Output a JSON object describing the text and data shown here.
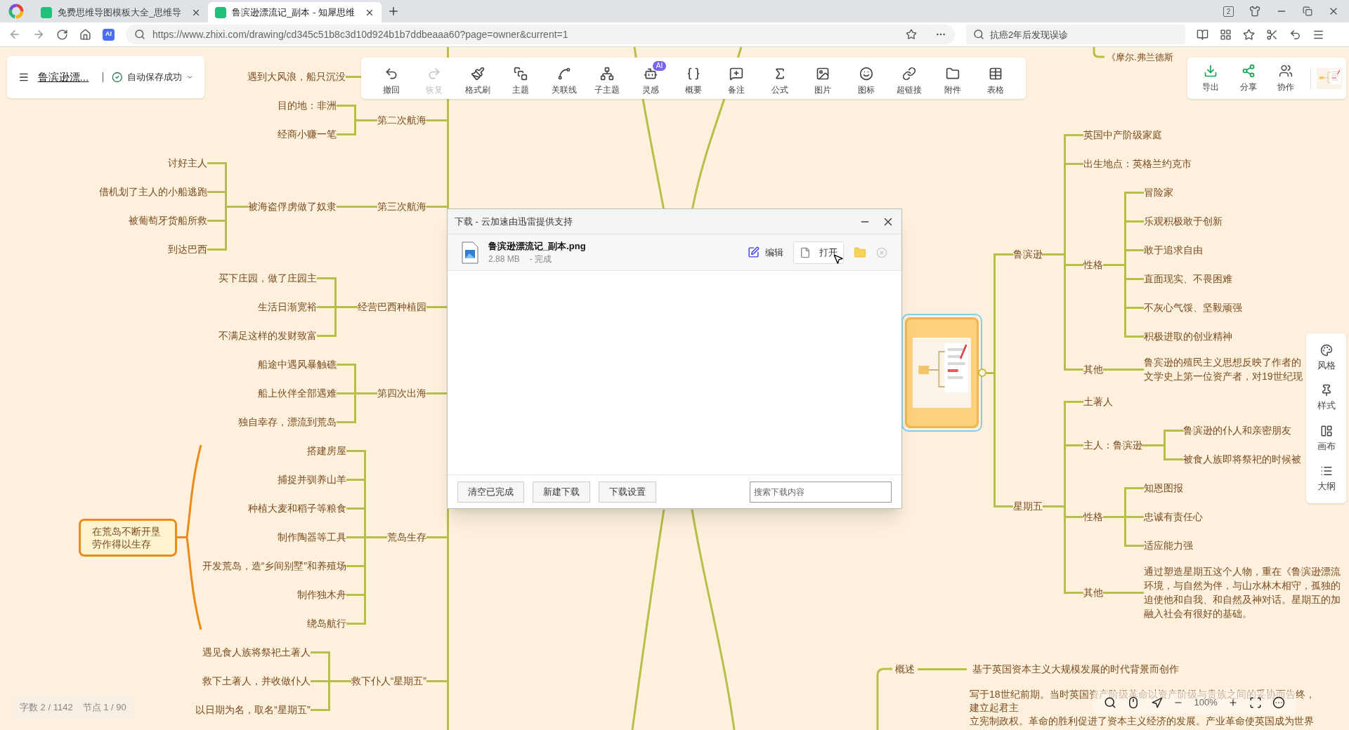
{
  "browser": {
    "tabs": [
      {
        "title": "免费思维导图模板大全_思维导",
        "selected": false
      },
      {
        "title": "鲁滨逊漂流记_副本 - 知犀思维",
        "selected": true
      }
    ],
    "group_count": "2",
    "ai_button": "AI",
    "url": "https://www.zhixi.com/drawing/cd345c51b8c3d10d924b1b7ddbeaaa60?page=owner&current=1",
    "search": {
      "placeholder": "抗癌2年后发现误诊"
    }
  },
  "header": {
    "doc_title": "鲁滨逊漂...",
    "save_status": "自动保存成功"
  },
  "toolbar": [
    {
      "label": "撤回",
      "disabled": false
    },
    {
      "label": "恢复",
      "disabled": true
    },
    {
      "label": "格式刷",
      "disabled": false
    },
    {
      "label": "主题",
      "disabled": false
    },
    {
      "label": "关联线",
      "disabled": false
    },
    {
      "label": "子主题",
      "disabled": false
    },
    {
      "label": "灵感",
      "disabled": false,
      "badge": "AI"
    },
    {
      "label": "概要",
      "disabled": false
    },
    {
      "label": "备注",
      "disabled": false
    },
    {
      "label": "公式",
      "disabled": false
    },
    {
      "label": "图片",
      "disabled": false
    },
    {
      "label": "图标",
      "disabled": false
    },
    {
      "label": "超链接",
      "disabled": false
    },
    {
      "label": "附件",
      "disabled": false
    },
    {
      "label": "表格",
      "disabled": false
    }
  ],
  "share_bar": [
    "导出",
    "分享",
    "协作"
  ],
  "mindmap": {
    "left": [
      {
        "children": [
          {
            "label": "遇到大风浪，船只沉没"
          }
        ]
      },
      {
        "label": "第二次航海",
        "children": [
          {
            "label": "目的地：非洲"
          },
          {
            "label": "经商小赚一笔"
          }
        ]
      },
      {
        "label": "第三次航海",
        "children": [
          {
            "label": "被海盗俘虏做了奴隶",
            "children": [
              {
                "label": "讨好主人"
              },
              {
                "label": "借机划了主人的小船逃跑"
              },
              {
                "label": "被葡萄牙货船所救"
              },
              {
                "label": "到达巴西"
              }
            ]
          }
        ]
      },
      {
        "label": "经营巴西种植园",
        "children": [
          {
            "label": "买下庄园，做了庄园主"
          },
          {
            "label": "生活日渐宽裕"
          },
          {
            "label": "不满足这样的发财致富"
          }
        ]
      },
      {
        "label": "第四次出海",
        "children": [
          {
            "label": "船途中遇风暴触礁"
          },
          {
            "label": "船上伙伴全部遇难"
          },
          {
            "label": "独自幸存，漂流到荒岛"
          }
        ]
      },
      {
        "label": "荒岛生存",
        "summary": "在荒岛不断开垦劳作得以生存",
        "children": [
          {
            "label": "搭建房屋"
          },
          {
            "label": "捕捉并驯养山羊"
          },
          {
            "label": "种植大麦和稻子等粮食"
          },
          {
            "label": "制作陶器等工具"
          },
          {
            "label": "开发荒岛，造“乡间别墅”和养殖场"
          },
          {
            "label": "制作独木舟"
          },
          {
            "label": "绕岛航行"
          }
        ]
      },
      {
        "label": "救下仆人“星期五”",
        "children": [
          {
            "label": "遇见食人族将祭祀土著人"
          },
          {
            "label": "救下土著人，并收做仆人"
          },
          {
            "label": "以日期为名，取名“星期五”"
          }
        ]
      }
    ],
    "right": [
      {
        "label": "鲁滨逊",
        "children": [
          {
            "label": "英国中产阶级家庭"
          },
          {
            "label": "出生地点：英格兰约克市"
          },
          {
            "label": "性格",
            "children": [
              {
                "label": "冒险家"
              },
              {
                "label": "乐观积极敢于创新"
              },
              {
                "label": "敢于追求自由"
              },
              {
                "label": "直面现实、不畏困难"
              },
              {
                "label": "不灰心气馁、坚毅顽强"
              },
              {
                "label": "积极进取的创业精神"
              }
            ]
          },
          {
            "label": "其他",
            "children": [
              {
                "lines": [
                  "鲁宾逊的殖民主义思想反映了作者的",
                  "文学史上第一位资产者，对19世纪现"
                ]
              }
            ]
          }
        ]
      },
      {
        "label": "星期五",
        "children": [
          {
            "label": "土著人"
          },
          {
            "label": "主人：鲁滨逊",
            "children": [
              {
                "label": "鲁滨逊的仆人和亲密朋友"
              },
              {
                "label": "被食人族即将祭祀的时候被"
              }
            ]
          },
          {
            "label": "性格",
            "children": [
              {
                "label": "知恩图报"
              },
              {
                "label": "忠诚有责任心"
              },
              {
                "label": "适应能力强"
              }
            ]
          },
          {
            "label": "其他",
            "children": [
              {
                "lines": [
                  "通过塑造星期五这个人物，重在《鲁滨逊漂流",
                  "环境，与自然为伴，与山水林木相守，孤独的",
                  "迫使他和自我、和自然及神对话。星期五的加",
                  "融入社会有很好的基础。"
                ]
              }
            ]
          }
        ]
      }
    ],
    "top_fragment": "《摩尔.弗兰德斯",
    "overview": {
      "label": "概述",
      "summary": "基于英国资本主义大规模发展的时代背景而创作",
      "lines": [
        "写于18世纪前期。当时英国资产阶级革命以资产阶级与贵族之间的妥协而告终，",
        "建立起君主",
        "立宪制政权。革命的胜利促进了资本主义经济的发展。产业革命使英国成为世界"
      ]
    }
  },
  "side_panel": [
    "风格",
    "样式",
    "画布",
    "大纲"
  ],
  "status": {
    "words": "字数 2 / 1142",
    "nodes": "节点 1 / 90"
  },
  "zoom_level": "100%",
  "dialog": {
    "title": "下载 - 云加速由迅雷提供支持",
    "file": {
      "name": "鲁滨逊漂流记_副本.png",
      "size": "2.88 MB",
      "status": "- 完成"
    },
    "edit": "编辑",
    "open": "打开",
    "buttons": [
      "清空已完成",
      "新建下载",
      "下载设置"
    ],
    "search": {
      "placeholder": "搜索下载内容"
    }
  }
}
